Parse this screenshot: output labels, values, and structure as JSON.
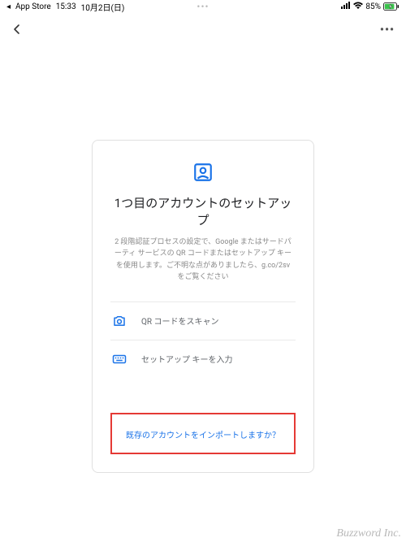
{
  "status_bar": {
    "back_app_arrow": "◂",
    "back_app": "App Store",
    "time": "15:33",
    "date": "10月2日(日)",
    "center_dots": "•••",
    "signal": "▪ı|",
    "wifi": "✓",
    "battery_pct": "85%"
  },
  "header": {
    "back": "‹",
    "more": "•••"
  },
  "card": {
    "title": "1つ目のアカウントのセットアップ",
    "description": "2 段階認証プロセスの設定で、Google またはサードパーティ サービスの QR コードまたはセットアップ キーを使用します。ご不明な点がありましたら、g.co/2sv をご覧ください",
    "options": [
      {
        "label": "QR コードをスキャン"
      },
      {
        "label": "セットアップ キーを入力"
      }
    ],
    "import_link": "既存のアカウントをインポートしますか？"
  },
  "watermark": "Buzzword Inc.",
  "colors": {
    "blue": "#1a73e8",
    "red": "#e53935"
  }
}
